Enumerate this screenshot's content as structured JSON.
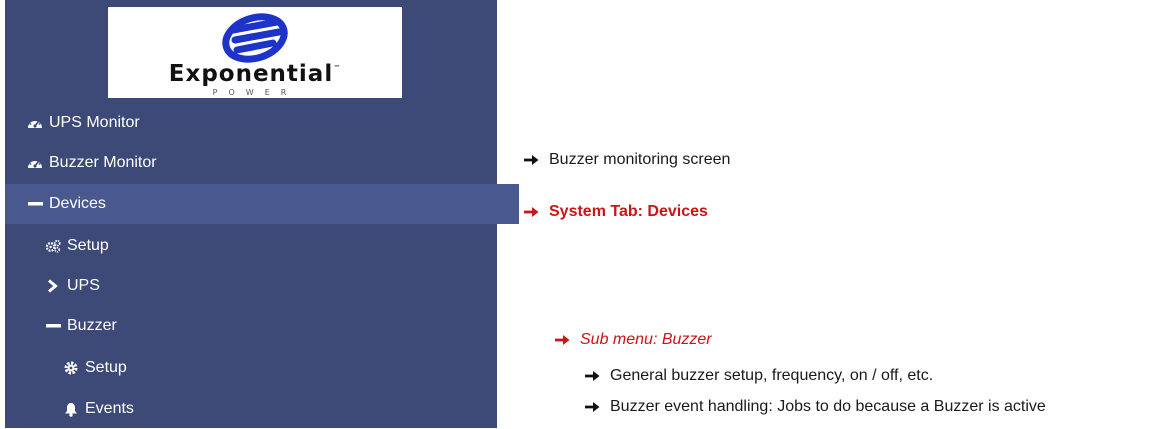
{
  "logo": {
    "wordmark": "Exponential",
    "trademark": "™",
    "sub": "POWER"
  },
  "sidebar": {
    "items": [
      {
        "label": "UPS Monitor",
        "icon": "dashboard-icon"
      },
      {
        "label": "Buzzer Monitor",
        "icon": "dashboard-icon"
      },
      {
        "label": "Devices",
        "icon": "minus-icon",
        "active": true
      },
      {
        "label": "Setup",
        "icon": "gears-icon"
      },
      {
        "label": "UPS",
        "icon": "chevron-right-icon"
      },
      {
        "label": "Buzzer",
        "icon": "minus-icon"
      },
      {
        "label": "Setup",
        "icon": "gear-icon"
      },
      {
        "label": "Events",
        "icon": "bell-icon"
      }
    ]
  },
  "notes": {
    "buzzer_monitor": "Buzzer monitoring screen",
    "system_tab": "System Tab: Devices",
    "sub_menu": "Sub menu: Buzzer",
    "general_setup": "General buzzer setup, frequency, on / off, etc.",
    "event_handling": "Buzzer event handling: Jobs to do because a Buzzer is active"
  },
  "colors": {
    "sidebar_bg": "#3d4a78",
    "sidebar_active": "#4a5890",
    "accent_red": "#cc1414",
    "logo_blue": "#1e33c8"
  }
}
